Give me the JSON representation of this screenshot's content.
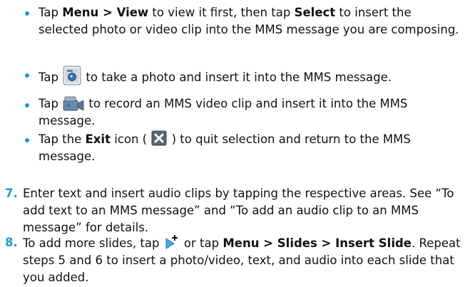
{
  "bullets": [
    {
      "parts": [
        {
          "t": "Tap ",
          "b": false
        },
        {
          "t": "Menu > View",
          "b": true
        },
        {
          "t": " to view it first, then tap ",
          "b": false
        },
        {
          "t": "Select",
          "b": true
        },
        {
          "t": " to insert the selected photo or video clip into the MMS message you are composing.",
          "b": false
        }
      ]
    },
    {
      "before": "Tap ",
      "icon": "camera-icon",
      "after": " to take a photo and insert it into the MMS message."
    },
    {
      "before": "Tap ",
      "icon": "video-camera-icon",
      "after": " to record an MMS video clip and insert it into the MMS message."
    },
    {
      "before1": "Tap the ",
      "bold": "Exit",
      "before2": " icon ( ",
      "icon": "close-icon",
      "after": " ) to quit selection and return to the MMS message."
    }
  ],
  "steps": [
    {
      "number": "7.",
      "text": "Enter text and insert audio clips by tapping the respective areas. See “To add text to an MMS message” and “To add an audio clip to an MMS message” for details."
    },
    {
      "number": "8.",
      "text1": "To add more slides, tap ",
      "icon": "insert-slide-icon",
      "text2": " or tap ",
      "bold1": "Menu > Slides > Insert Slide",
      "text3": ". Repeat steps 5 and 6 to insert a photo/video, text, and audio into each slide that you added."
    }
  ],
  "colors": {
    "accent": "#1f9ad6",
    "text": "#111111"
  }
}
